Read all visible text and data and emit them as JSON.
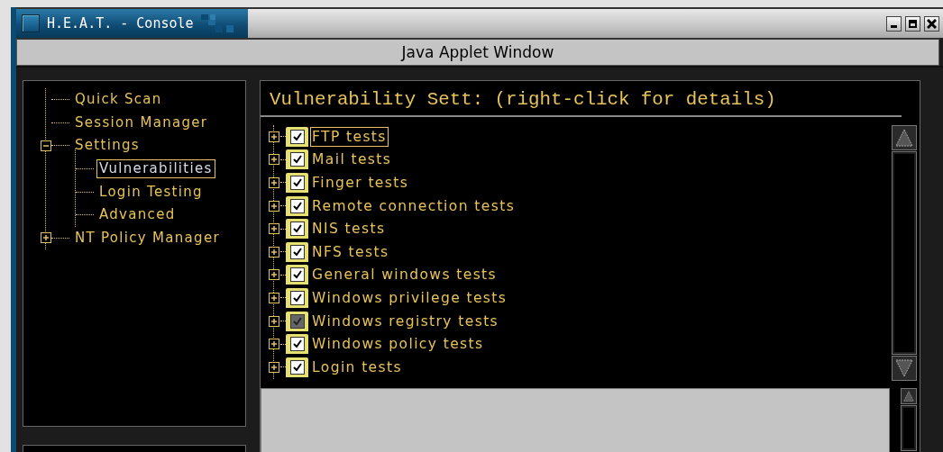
{
  "window": {
    "title": "H.E.A.T. - Console",
    "applet_banner": "Java Applet Window"
  },
  "nav_tree": [
    {
      "label": "Quick Scan",
      "kind": "leaf",
      "selected": false
    },
    {
      "label": "Session Manager",
      "kind": "leaf",
      "selected": false
    },
    {
      "label": "Settings",
      "kind": "folder",
      "expanded": true,
      "selected": false,
      "children": [
        {
          "label": "Vulnerabilities",
          "kind": "leaf",
          "selected": true
        },
        {
          "label": "Login Testing",
          "kind": "leaf",
          "selected": false
        },
        {
          "label": "Advanced",
          "kind": "leaf",
          "selected": false
        }
      ]
    },
    {
      "label": "NT Policy Manager",
      "kind": "folder",
      "expanded": false,
      "selected": false
    }
  ],
  "panel": {
    "title": "Vulnerability Sett: (right-click for details)",
    "tests": [
      {
        "label": "FTP tests",
        "kind": "full",
        "expanded": false,
        "checked": true,
        "selected": true
      },
      {
        "label": "Mail tests",
        "kind": "full",
        "expanded": false,
        "checked": true,
        "selected": false
      },
      {
        "label": "Finger tests",
        "kind": "full",
        "expanded": false,
        "checked": true,
        "selected": false
      },
      {
        "label": "Remote connection tests",
        "kind": "full",
        "expanded": false,
        "checked": true,
        "selected": false
      },
      {
        "label": "NIS tests",
        "kind": "full",
        "expanded": false,
        "checked": true,
        "selected": false
      },
      {
        "label": "NFS tests",
        "kind": "full",
        "expanded": false,
        "checked": true,
        "selected": false
      },
      {
        "label": "General windows tests",
        "kind": "full",
        "expanded": false,
        "checked": true,
        "selected": false
      },
      {
        "label": "Windows privilege tests",
        "kind": "full",
        "expanded": false,
        "checked": true,
        "selected": false
      },
      {
        "label": "Windows registry tests",
        "kind": "partial",
        "expanded": false,
        "checked": true,
        "selected": false
      },
      {
        "label": "Windows policy tests",
        "kind": "full",
        "expanded": false,
        "checked": true,
        "selected": false
      },
      {
        "label": "Login tests",
        "kind": "full",
        "expanded": false,
        "checked": true,
        "selected": false
      }
    ]
  }
}
